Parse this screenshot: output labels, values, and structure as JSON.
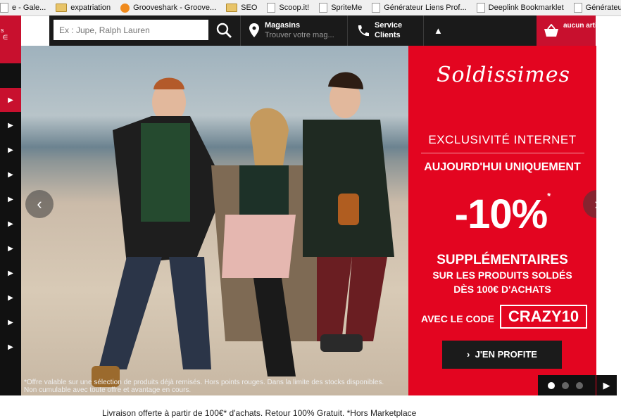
{
  "bookmarks": [
    {
      "label": "e - Gale...",
      "icon": "page-icon"
    },
    {
      "label": "expatriation",
      "icon": "folder-icon"
    },
    {
      "label": "Grooveshark - Groove...",
      "icon": "grooveshark-icon"
    },
    {
      "label": "SEO",
      "icon": "folder-icon"
    },
    {
      "label": "Scoop.it!",
      "icon": "page-icon"
    },
    {
      "label": "SpriteMe",
      "icon": "page-icon"
    },
    {
      "label": "Générateur Liens Prof...",
      "icon": "page-icon"
    },
    {
      "label": "Deeplink Bookmarklet",
      "icon": "page-icon"
    },
    {
      "label": "Générateur Liens",
      "icon": "page-icon"
    }
  ],
  "header": {
    "search_placeholder": "Ex : Jupe, Ralph Lauren",
    "stores_title": "Magasins",
    "stores_sub": "Trouver votre mag...",
    "service_line1": "Service",
    "service_line2": "Clients",
    "cart_label": "aucun article"
  },
  "banner": {
    "brand_script": "Soldissimes",
    "exclusivity": "EXCLUSIVITÉ INTERNET",
    "today": "AUJOURD'HUI UNIQUEMENT",
    "discount": "-10%",
    "discount_mark": "*",
    "supplementary": "SUPPLÉMENTAIRES",
    "on_products": "SUR LES PRODUITS SOLDÉS",
    "from_amount": "DÈS 100€ D'ACHATS",
    "with_code": "AVEC LE CODE",
    "promo_code": "CRAZY10",
    "cta": "J'EN PROFITE",
    "disclaimer": "*Offre valable sur une sélection de produits déjà remisés. Hors points rouges. Dans la limite des stocks disponibles. Non cumulable avec toute offre et avantage en cours.",
    "slides_total": 3,
    "active_slide": 1
  },
  "footer_note": "Livraison offerte à partir de 100€* d'achats. Retour 100% Gratuit. *Hors Marketplace",
  "colors": {
    "accent_red": "#e30520",
    "header_bg": "#1a1a1a",
    "cta_bg": "#1b1b1b"
  }
}
